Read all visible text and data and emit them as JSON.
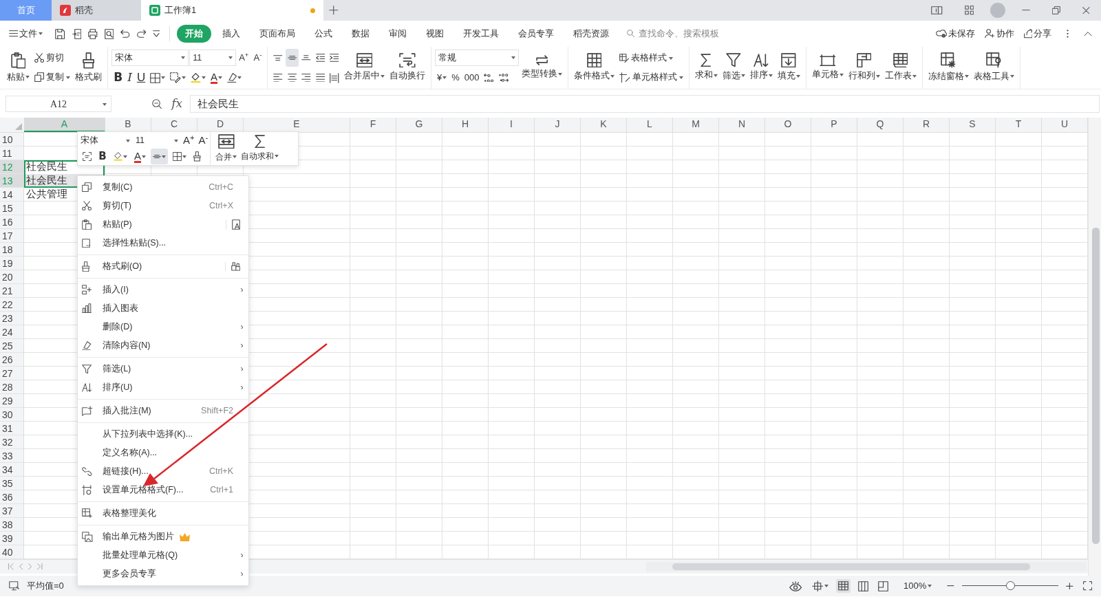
{
  "tabs": [
    {
      "kind": "home",
      "label": "首页",
      "selected": false,
      "unsaved": false
    },
    {
      "kind": "docer",
      "label": "稻壳",
      "selected": false,
      "unsaved": false
    },
    {
      "kind": "sheet",
      "label": "工作簿1",
      "selected": true,
      "unsaved": true
    }
  ],
  "menu_bar": {
    "file_menu": "文件",
    "ribbon_tabs": [
      {
        "label": "开始",
        "selected": true
      },
      {
        "label": "插入",
        "selected": false
      },
      {
        "label": "页面布局",
        "selected": false
      },
      {
        "label": "公式",
        "selected": false
      },
      {
        "label": "数据",
        "selected": false
      },
      {
        "label": "审阅",
        "selected": false
      },
      {
        "label": "视图",
        "selected": false
      },
      {
        "label": "开发工具",
        "selected": false
      },
      {
        "label": "会员专享",
        "selected": false
      },
      {
        "label": "稻壳资源",
        "selected": false
      }
    ],
    "search": {
      "placeholder": "查找命令、搜索模板"
    },
    "actions": [
      {
        "kind": "cloud",
        "label": "未保存"
      },
      {
        "kind": "collab",
        "label": "协作"
      },
      {
        "kind": "share",
        "label": "分享"
      }
    ]
  },
  "ribbon": [
    {
      "parts": [
        {
          "kind": "large",
          "items": [
            {
              "kind": "paste",
              "label": "粘贴",
              "dropdown": true
            }
          ]
        },
        {
          "kind": "stack",
          "items": [
            {
              "kind": "cut",
              "label": "剪切",
              "dropdown": false
            },
            {
              "kind": "copy",
              "label": "复制",
              "dropdown": true
            }
          ]
        },
        {
          "kind": "large",
          "items": [
            {
              "kind": "brush",
              "label": "格式刷",
              "dropdown": false
            }
          ]
        }
      ]
    },
    {
      "parts": [
        {
          "kind": "rows",
          "top": [
            {
              "kind": "font-select",
              "value": "宋体"
            },
            {
              "kind": "size-select",
              "value": "11"
            },
            {
              "kind": "grow",
              "label": "A$^{+}$",
              "dropdown": false
            },
            {
              "kind": "shrink",
              "label": "A$^{-}$",
              "dropdown": false
            }
          ],
          "bottom": [
            {
              "kind": "bold",
              "label": "B",
              "dropdown": false
            },
            {
              "kind": "italic",
              "label": "I",
              "dropdown": false
            },
            {
              "kind": "underline",
              "label": "U",
              "dropdown": false
            },
            {
              "kind": "border",
              "dropdown": true
            },
            {
              "kind": "cell-format",
              "dropdown": true
            },
            {
              "kind": "fill-color",
              "dropdown": true
            },
            {
              "kind": "font-color",
              "label": "A",
              "dropdown": true
            },
            {
              "kind": "eraser",
              "dropdown": true
            }
          ]
        }
      ]
    },
    {
      "parts": [
        {
          "kind": "rows",
          "top": [
            {
              "kind": "align-top",
              "selected": false
            },
            {
              "kind": "align-middle",
              "selected": true
            },
            {
              "kind": "align-bottom",
              "selected": false
            },
            {
              "kind": "outdent",
              "selected": false
            },
            {
              "kind": "indent",
              "selected": false
            }
          ],
          "bottom": [
            {
              "kind": "align-left",
              "selected": false
            },
            {
              "kind": "align-center",
              "selected": false
            },
            {
              "kind": "align-right",
              "selected": false
            },
            {
              "kind": "justify",
              "selected": false
            },
            {
              "kind": "distribute",
              "selected": false
            }
          ]
        },
        {
          "kind": "large",
          "items": [
            {
              "kind": "merge",
              "label": "合并居中",
              "dropdown": true
            }
          ]
        },
        {
          "kind": "large",
          "items": [
            {
              "kind": "wrap",
              "label": "自动换行",
              "dropdown": false
            }
          ]
        }
      ]
    },
    {
      "parts": [
        {
          "kind": "rows",
          "top": [
            {
              "kind": "format-select",
              "value": "常规"
            }
          ],
          "bottom": [
            {
              "kind": "currency",
              "label": "¥",
              "dropdown": true
            },
            {
              "kind": "percent",
              "label": "%",
              "dropdown": false
            },
            {
              "kind": "thousands",
              "label": "000",
              "dropdown": false
            },
            {
              "kind": "inc-decimal",
              "dropdown": false
            },
            {
              "kind": "dec-decimal",
              "dropdown": false
            }
          ]
        },
        {
          "kind": "large",
          "items": [
            {
              "kind": "convert",
              "label": "类型转换",
              "dropdown": true
            }
          ]
        }
      ]
    },
    {
      "parts": [
        {
          "kind": "large",
          "items": [
            {
              "kind": "conditional",
              "label": "条件格式",
              "dropdown": true
            }
          ]
        },
        {
          "kind": "stack",
          "items": [
            {
              "kind": "table-style",
              "label": "表格样式",
              "dropdown": true
            },
            {
              "kind": "cell-style",
              "label": "单元格样式",
              "dropdown": true
            }
          ]
        }
      ]
    },
    {
      "parts": [
        {
          "kind": "large",
          "items": [
            {
              "kind": "sum",
              "label": "求和",
              "dropdown": true
            }
          ]
        },
        {
          "kind": "large",
          "items": [
            {
              "kind": "filter",
              "label": "筛选",
              "dropdown": true
            }
          ]
        },
        {
          "kind": "large",
          "items": [
            {
              "kind": "sort",
              "label": "排序",
              "dropdown": true
            }
          ]
        },
        {
          "kind": "large",
          "items": [
            {
              "kind": "fill-down",
              "label": "填充",
              "dropdown": true
            }
          ]
        }
      ]
    },
    {
      "parts": [
        {
          "kind": "large",
          "items": [
            {
              "kind": "cells",
              "label": "单元格",
              "dropdown": true
            }
          ]
        },
        {
          "kind": "large",
          "items": [
            {
              "kind": "rowcol",
              "label": "行和列",
              "dropdown": true
            }
          ]
        },
        {
          "kind": "large",
          "items": [
            {
              "kind": "sheet",
              "label": "工作表",
              "dropdown": true
            }
          ]
        }
      ]
    },
    {
      "parts": [
        {
          "kind": "large",
          "items": [
            {
              "kind": "freeze",
              "label": "冻结窗格",
              "dropdown": true
            }
          ]
        },
        {
          "kind": "large",
          "items": [
            {
              "kind": "tools",
              "label": "表格工具",
              "dropdown": true
            }
          ]
        }
      ]
    }
  ],
  "formula_bar": {
    "name_box": "A12",
    "fx": "fx",
    "formula": "社会民生"
  },
  "columns": [
    {
      "label": "A",
      "selected": true
    },
    {
      "label": "B",
      "selected": false
    },
    {
      "label": "C",
      "selected": false
    },
    {
      "label": "D",
      "selected": false
    },
    {
      "label": "E",
      "selected": false
    },
    {
      "label": "F",
      "selected": false
    },
    {
      "label": "G",
      "selected": false
    },
    {
      "label": "H",
      "selected": false
    },
    {
      "label": "I",
      "selected": false
    },
    {
      "label": "J",
      "selected": false
    },
    {
      "label": "K",
      "selected": false
    },
    {
      "label": "L",
      "selected": false
    },
    {
      "label": "M",
      "selected": false
    },
    {
      "label": "N",
      "selected": false
    },
    {
      "label": "O",
      "selected": false
    },
    {
      "label": "P",
      "selected": false
    },
    {
      "label": "Q",
      "selected": false
    },
    {
      "label": "R",
      "selected": false
    },
    {
      "label": "S",
      "selected": false
    },
    {
      "label": "T",
      "selected": false
    },
    {
      "label": "U",
      "selected": false
    }
  ],
  "rows": [
    {
      "number": "10",
      "selected": false
    },
    {
      "number": "11",
      "selected": false
    },
    {
      "number": "12",
      "selected": true,
      "cell_a": "社会民生"
    },
    {
      "number": "13",
      "selected": true,
      "cell_a": "社会民生"
    },
    {
      "number": "14",
      "selected": false,
      "cell_a": "公共管理"
    },
    {
      "number": "15",
      "selected": false
    },
    {
      "number": "16",
      "selected": false
    },
    {
      "number": "17",
      "selected": false
    },
    {
      "number": "18",
      "selected": false
    },
    {
      "number": "19",
      "selected": false
    },
    {
      "number": "20",
      "selected": false
    },
    {
      "number": "21",
      "selected": false
    },
    {
      "number": "22",
      "selected": false
    },
    {
      "number": "23",
      "selected": false
    },
    {
      "number": "24",
      "selected": false
    },
    {
      "number": "25",
      "selected": false
    },
    {
      "number": "26",
      "selected": false
    },
    {
      "number": "27",
      "selected": false
    },
    {
      "number": "28",
      "selected": false
    },
    {
      "number": "29",
      "selected": false
    },
    {
      "number": "30",
      "selected": false
    },
    {
      "number": "31",
      "selected": false
    },
    {
      "number": "32",
      "selected": false
    },
    {
      "number": "33",
      "selected": false
    },
    {
      "number": "34",
      "selected": false
    },
    {
      "number": "35",
      "selected": false
    },
    {
      "number": "36",
      "selected": false
    },
    {
      "number": "37",
      "selected": false
    },
    {
      "number": "38",
      "selected": false
    },
    {
      "number": "39",
      "selected": false
    },
    {
      "number": "40",
      "selected": false
    }
  ],
  "mini_toolbar": {
    "font": "宋体",
    "size": "11",
    "grow": "A$^{+}$",
    "shrink": "A$^{-}$",
    "buttons": [
      {
        "kind": "select-range",
        "dropdown": false,
        "highlighted": false
      },
      {
        "kind": "bold",
        "label": "B",
        "dropdown": false,
        "highlighted": false
      },
      {
        "kind": "fill-color",
        "dropdown": true,
        "highlighted": false
      },
      {
        "kind": "font-color",
        "label": "A",
        "dropdown": true,
        "highlighted": false
      },
      {
        "kind": "align-middle",
        "dropdown": true,
        "highlighted": true
      },
      {
        "kind": "border",
        "dropdown": true,
        "highlighted": false
      },
      {
        "kind": "brush",
        "dropdown": false,
        "highlighted": false
      }
    ],
    "large": [
      {
        "kind": "merge",
        "label": "合并",
        "dropdown": true
      },
      {
        "kind": "sum",
        "label": "自动求和",
        "dropdown": true
      }
    ]
  },
  "context_menu": {
    "sections": [
      [
        {
          "kind": "copy",
          "label": "复制(C)",
          "shortcut": "Ctrl+C",
          "submenu": false,
          "side_button": false,
          "premium": false
        },
        {
          "kind": "cut",
          "label": "剪切(T)",
          "shortcut": "Ctrl+X",
          "submenu": false,
          "side_button": false,
          "premium": false
        },
        {
          "kind": "paste",
          "label": "粘贴(P)",
          "submenu": false,
          "side_button": true,
          "premium": false
        },
        {
          "kind": "paste-special",
          "label": "选择性粘贴(S)...",
          "submenu": false,
          "side_button": false,
          "premium": false
        }
      ],
      [
        {
          "kind": "brush",
          "label": "格式刷(O)",
          "submenu": false,
          "side_button": true,
          "premium": false
        }
      ],
      [
        {
          "kind": "insert",
          "label": "插入(I)",
          "submenu": true,
          "side_button": false,
          "premium": false
        },
        {
          "kind": "chart",
          "label": "插入图表",
          "submenu": false,
          "side_button": false,
          "premium": false
        },
        {
          "kind": "plain",
          "label": "删除(D)",
          "submenu": true,
          "side_button": false,
          "premium": false
        },
        {
          "kind": "clear",
          "label": "清除内容(N)",
          "submenu": true,
          "side_button": false,
          "premium": false
        }
      ],
      [
        {
          "kind": "filter",
          "label": "筛选(L)",
          "submenu": true,
          "side_button": false,
          "premium": false
        },
        {
          "kind": "sort",
          "label": "排序(U)",
          "submenu": true,
          "side_button": false,
          "premium": false
        }
      ],
      [
        {
          "kind": "comment",
          "label": "插入批注(M)",
          "shortcut": "Shift+F2",
          "submenu": false,
          "side_button": false,
          "premium": false
        }
      ],
      [
        {
          "kind": "plain",
          "label": "从下拉列表中选择(K)...",
          "submenu": false,
          "side_button": false,
          "premium": false
        },
        {
          "kind": "plain",
          "label": "定义名称(A)...",
          "submenu": false,
          "side_button": false,
          "premium": false
        },
        {
          "kind": "link",
          "label": "超链接(H)...",
          "shortcut": "Ctrl+K",
          "submenu": false,
          "side_button": false,
          "premium": false
        },
        {
          "kind": "format-cells",
          "label": "设置单元格格式(F)...",
          "shortcut": "Ctrl+1",
          "submenu": false,
          "side_button": false,
          "premium": false
        }
      ],
      [
        {
          "kind": "beautify",
          "label": "表格整理美化",
          "submenu": false,
          "side_button": false,
          "premium": false
        }
      ],
      [
        {
          "kind": "export-image",
          "label": "输出单元格为图片",
          "submenu": false,
          "side_button": false,
          "premium": true
        },
        {
          "kind": "plain",
          "label": "批量处理单元格(Q)",
          "submenu": true,
          "side_button": false,
          "premium": false
        },
        {
          "kind": "plain",
          "label": "更多会员专享",
          "submenu": true,
          "side_button": false,
          "premium": false
        }
      ]
    ]
  },
  "status_bar": {
    "summary": "平均值=0",
    "view_modes": [
      {
        "kind": "normal",
        "selected": true
      },
      {
        "kind": "page-break",
        "selected": false
      },
      {
        "kind": "page-layout",
        "selected": false
      }
    ],
    "zoom": "100%",
    "zoom_slider": {
      "level": 0.5
    }
  },
  "annotation": {
    "kind": "arrow"
  }
}
